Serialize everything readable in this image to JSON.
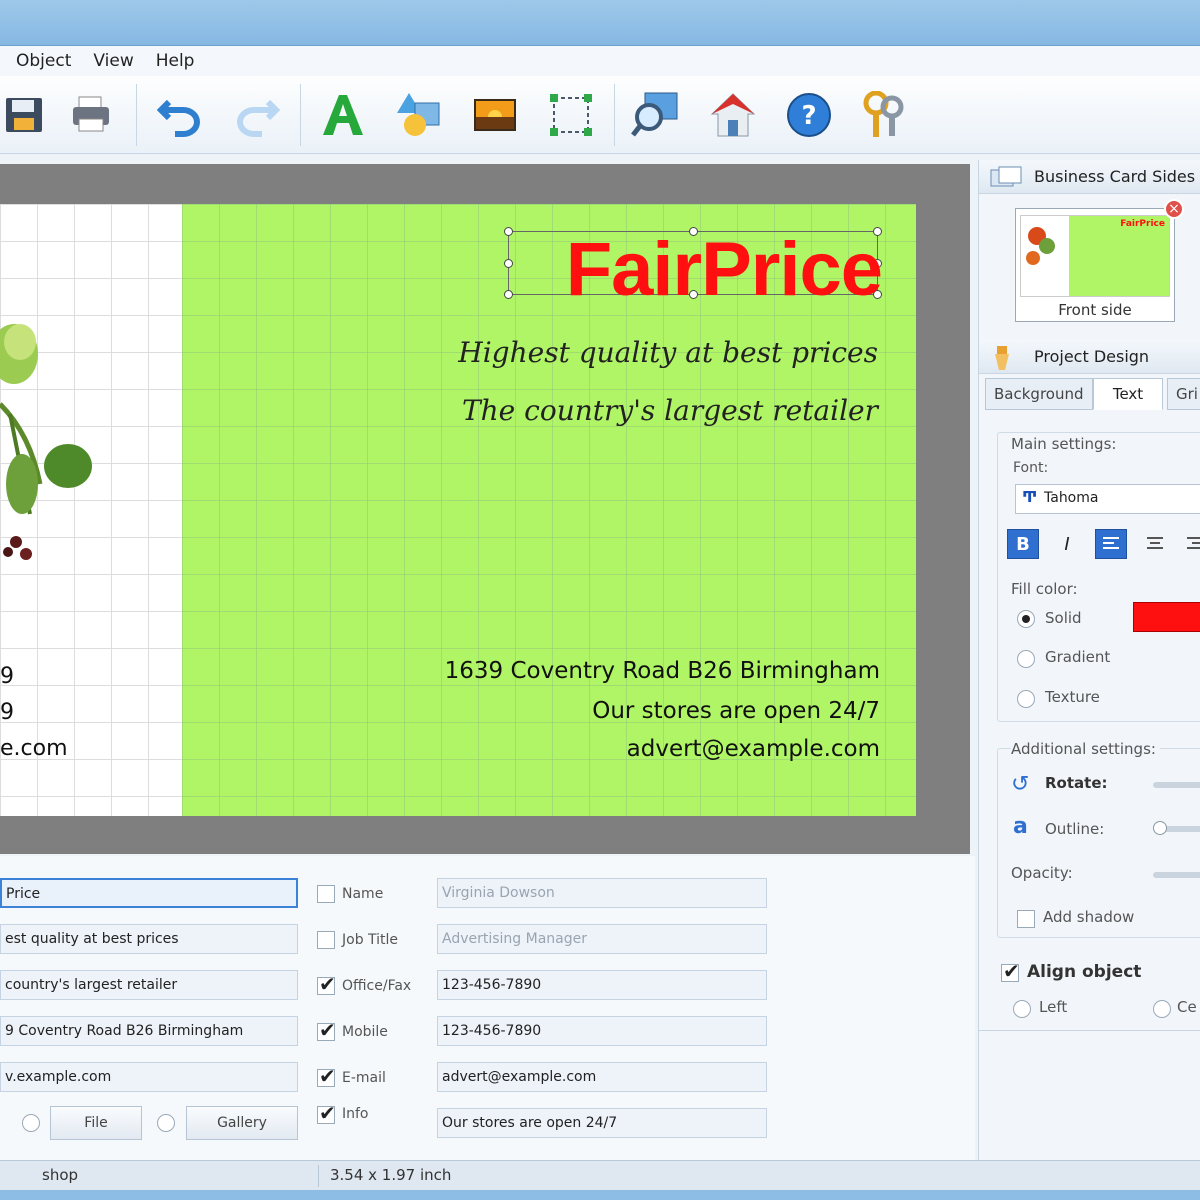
{
  "menu": [
    "Object",
    "View",
    "Help"
  ],
  "toolbar_icons": [
    "save-icon",
    "print-icon",
    "undo-icon",
    "redo-icon",
    "text-tool-icon",
    "shapes-icon",
    "image-icon",
    "select-icon",
    "zoom-icon",
    "home-icon",
    "help-icon",
    "keys-icon"
  ],
  "card": {
    "brand": "FairPrice",
    "slogan1": "Highest quality at best prices",
    "slogan2": "The country's largest retailer",
    "address": "1639 Coventry Road B26 Birmingham",
    "hours": "Our stores are open 24/7",
    "email": "advert@example.com",
    "left_fragment": "e.com",
    "colors": {
      "green": "#b0f566",
      "brand": "#ff0f0f"
    }
  },
  "form": {
    "left_fields": [
      "Price",
      "est quality at best prices",
      "country's largest retailer",
      "9 Coventry Road B26 Birmingham",
      "v.example.com"
    ],
    "right_rows": [
      {
        "label": "Name",
        "checked": false,
        "value": "Virginia Dowson"
      },
      {
        "label": "Job Title",
        "checked": false,
        "value": "Advertising Manager"
      },
      {
        "label": "Office/Fax",
        "checked": true,
        "value": "123-456-7890"
      },
      {
        "label": "Mobile",
        "checked": true,
        "value": "123-456-7890"
      },
      {
        "label": "E-mail",
        "checked": true,
        "value": "advert@example.com"
      },
      {
        "label": "Info",
        "checked": true,
        "value": "Our stores are open 24/7"
      }
    ],
    "file_btn": "File",
    "gallery_btn": "Gallery"
  },
  "status": {
    "left": "shop",
    "size": "3.54 x 1.97 inch"
  },
  "panel": {
    "sides_title": "Business Card Sides",
    "front_side": "Front side",
    "thumb_brand": "FairPrice",
    "design_title": "Project Design",
    "tabs": [
      "Background",
      "Text",
      "Gri"
    ],
    "main_settings": "Main settings:",
    "font_label": "Font:",
    "font_value": "Tahoma",
    "bold": "B",
    "italic": "I",
    "fill_color": "Fill color:",
    "fill_options": [
      "Solid",
      "Gradient",
      "Texture"
    ],
    "fill_swatch": "#ff1010",
    "additional": "Additional settings:",
    "rotate": "Rotate:",
    "outline": "Outline:",
    "opacity": "Opacity:",
    "add_shadow": "Add shadow",
    "align_object": "Align object",
    "align_options": [
      "Left",
      "Ce"
    ]
  }
}
